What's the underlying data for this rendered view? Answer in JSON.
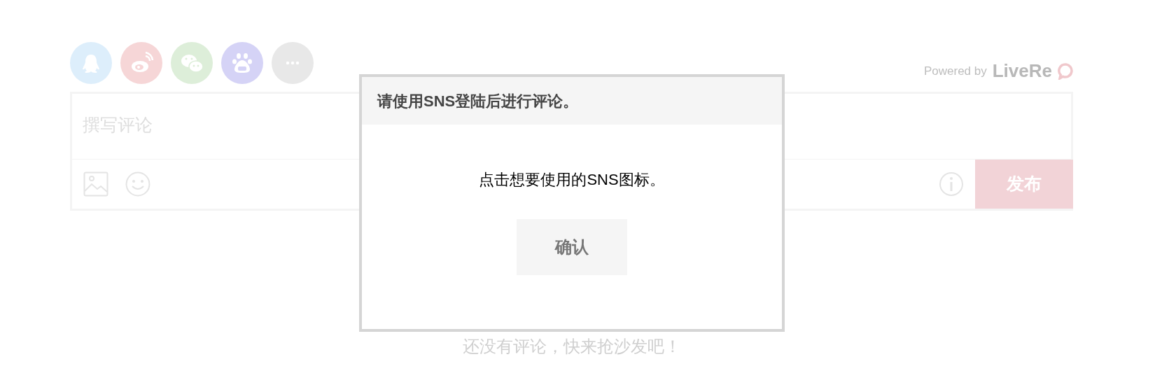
{
  "sns_buttons": [
    {
      "kind": "qq",
      "color": "#ddeefb"
    },
    {
      "kind": "weibo",
      "color": "#f6d6d7"
    },
    {
      "kind": "wechat",
      "color": "#ddeed9"
    },
    {
      "kind": "baidu",
      "color": "#d5d3f6"
    },
    {
      "kind": "more",
      "color": "#e8e8e8"
    }
  ],
  "powered_by": {
    "text": "Powered by",
    "brand": "LiveRe"
  },
  "editor": {
    "placeholder": "撰写评论",
    "publish_button": "发布"
  },
  "empty_message": "还没有评论，快来抢沙发吧！",
  "dialog": {
    "title": "请使用SNS登陆后进行评论。",
    "message": "点击想要使用的SNS图标。",
    "confirm_button": "确认"
  }
}
